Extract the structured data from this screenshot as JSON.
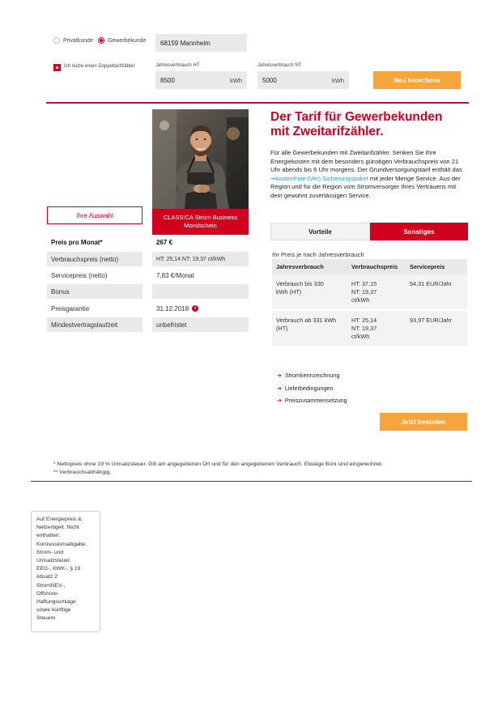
{
  "customer_type": {
    "options": [
      "Privatkunde",
      "Gewerbekunde"
    ],
    "selected": "Gewerbekunde"
  },
  "location_value": "68159 Mannheim",
  "double_meter": {
    "label": "Ich nutze einen Doppeltarifzähler",
    "checked": true
  },
  "consumption_ht": {
    "label": "Jahresverbrauch HT",
    "value": "8500",
    "unit": "kWh"
  },
  "consumption_nt": {
    "label": "Jahresverbrauch NT",
    "value": "5000",
    "unit": "kWh"
  },
  "recalculate_label": "Neu berechnen",
  "selection_label": "Ihre Auswahl",
  "product": {
    "name_line1": "CLASSICA Strom Business",
    "name_line2": "Mondschein"
  },
  "specs": [
    {
      "label": "Preis pro Monat*",
      "value": "267 €"
    },
    {
      "label": "Verbrauchspreis (netto)",
      "value": "HT: 25,14  NT: 19,37 ct/kWh"
    },
    {
      "label": "Servicepreis (netto)",
      "value": "7,83 €/Monat"
    },
    {
      "label": "Bonus",
      "value": ""
    },
    {
      "label": "Preisgarantie",
      "value": "31.12.2018"
    },
    {
      "label": "Mindestvertragslaufzeit",
      "value": "unbefristet"
    }
  ],
  "info_icon_glyph": "i",
  "headline": {
    "line1": "Der Tarif für Gewerbekunden",
    "line2": "mit Zweitarifzähler."
  },
  "description": {
    "part1": "Für alle Gewerbekunden mit Zweitarifzähler. Senken Sie Ihre Energiekosten mit dem besonders günstigen Verbrauchspreis von 21 Uhr abends bis 6 Uhr morgens. Der Grundversorgungstarif enthält das ",
    "link": "➞kostenfreie (Ver) Sicherungspaket",
    "part2": " mit jeder Menge Service. Aus der Region und für die Region vom Stromversorger Ihres Vertrauens mit dem gewohnt zuverlässigen Service."
  },
  "tabs": [
    {
      "label": "Vorteile",
      "active": false
    },
    {
      "label": "Sonstiges",
      "active": true
    }
  ],
  "price_note": "Ihr Preis je nach Jahresverbrauch",
  "price_table": {
    "headers": [
      "Jahresverbrauch",
      "Verbrauchspreis",
      "Servicepreis"
    ],
    "rows": [
      {
        "consumption": [
          "Verbrauch bis 330",
          "kWh (HT)"
        ],
        "price": [
          "HT: 37,15",
          "NT: 19,37",
          "ct/kWh"
        ],
        "service": "54,31 EUR/Jahr"
      },
      {
        "consumption": [
          "Verbrauch ab 331 kWh",
          "(HT)"
        ],
        "price": [
          "HT: 25,14",
          "NT: 19,37",
          "ct/kWh"
        ],
        "service": "93,97 EUR/Jahr"
      }
    ]
  },
  "document_links": [
    "Stromkennzeichnung",
    "Lieferbedingungen",
    "Preiszusammensetzung"
  ],
  "link_arrow": "➔",
  "order_label": "Jetzt bestellen",
  "footnotes": [
    "* Nettopreis ohne 19 % Umsatzsteuer. Gilt am angegebenen Ort und für den angegebenen Verbrauch. Etwaige Boni sind eingerechnet.",
    "** Verbrauchsabhängig."
  ],
  "tooltip_lines": [
    "Auf Energiepreis &",
    "Netzentgelt. Nicht",
    "enthalten:",
    "Konzessionsabgabe,",
    "Strom- und",
    "Umsatzsteuer,",
    "EEG-, KWK-, § 19",
    "Absatz 2",
    "StromNEV-,",
    "Offshore-",
    "Haftungsumlage",
    "sowie künftige",
    "Steuern"
  ],
  "colors": {
    "brand_red": "#d1001f",
    "orange": "#f7a43a",
    "link_blue": "#1aa3d5",
    "field_grey": "#e9e9e9"
  }
}
